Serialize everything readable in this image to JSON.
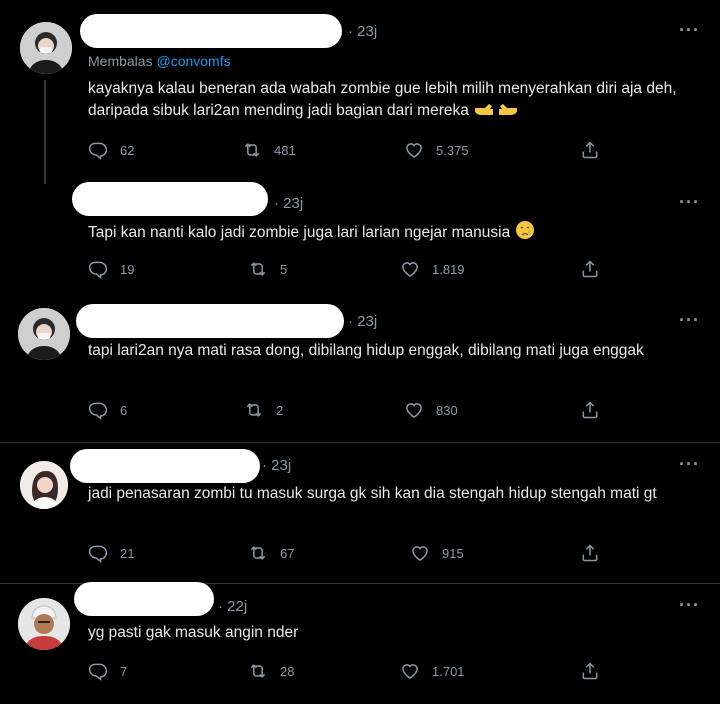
{
  "tweets": [
    {
      "time": "23j",
      "reply_label": "Membalas",
      "reply_handle": "@convomfs",
      "text": "kayaknya kalau beneran ada wabah zombie gue lebih milih menyerahkan diri aja deh, daripada sibuk lari2an mending jadi bagian dari mereka",
      "replies": "62",
      "retweets": "481",
      "likes": "5.375"
    },
    {
      "time": "23j",
      "text": "Tapi kan nanti kalo jadi zombie juga lari larian ngejar manusia",
      "replies": "19",
      "retweets": "5",
      "likes": "1.819"
    },
    {
      "time": "23j",
      "text": "tapi lari2an nya mati rasa dong, dibilang hidup enggak, dibilang mati juga enggak",
      "replies": "6",
      "retweets": "2",
      "likes": "830"
    },
    {
      "time": "23j",
      "text": "jadi penasaran zombi tu masuk surga gk sih kan dia stengah hidup stengah mati gt",
      "replies": "21",
      "retweets": "67",
      "likes": "915"
    },
    {
      "time": "22j",
      "text": "yg pasti gak masuk angin nder",
      "replies": "7",
      "retweets": "28",
      "likes": "1.701"
    }
  ],
  "icons": {
    "reply": "reply-icon",
    "retweet": "retweet-icon",
    "like": "heart-icon",
    "share": "share-icon",
    "more": "more-icon"
  },
  "colors": {
    "background": "#000000",
    "text": "#e7e9ea",
    "muted": "#8b98a5",
    "link": "#1d9bf0"
  }
}
